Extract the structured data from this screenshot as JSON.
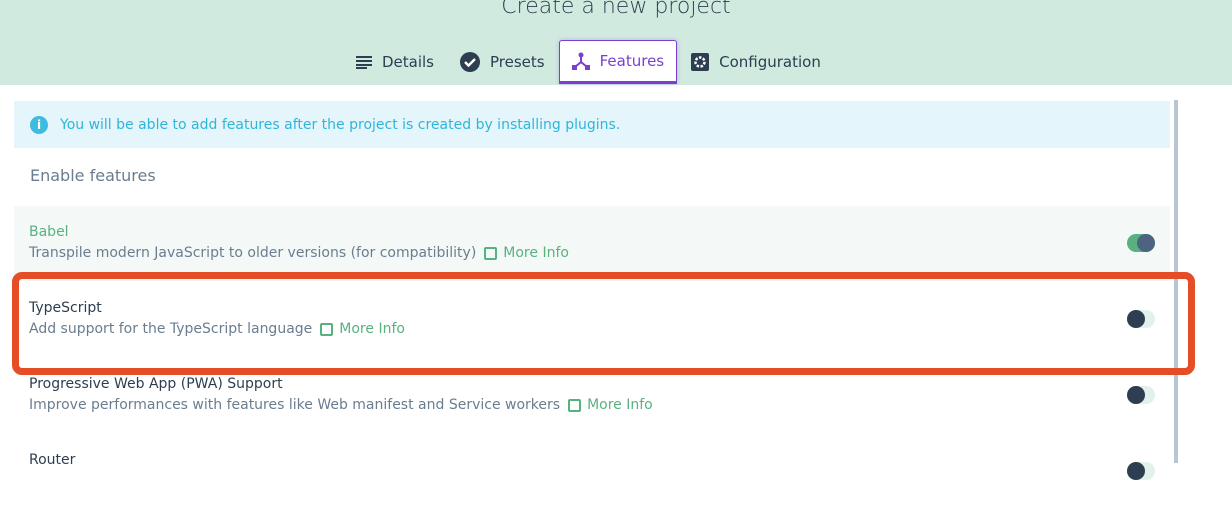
{
  "header": {
    "title": "Create a new project",
    "tabs": [
      {
        "label": "Details",
        "icon": "list-icon"
      },
      {
        "label": "Presets",
        "icon": "check-circle-icon"
      },
      {
        "label": "Features",
        "icon": "fork-icon",
        "active": true
      },
      {
        "label": "Configuration",
        "icon": "gear-icon"
      }
    ]
  },
  "info": {
    "text": "You will be able to add features after the project is created by installing plugins."
  },
  "section_title": "Enable features",
  "features": [
    {
      "name": "Babel",
      "description": "Transpile modern JavaScript to older versions (for compatibility)",
      "link": "More Info",
      "enabled": true
    },
    {
      "name": "TypeScript",
      "description": "Add support for the TypeScript language",
      "link": "More Info",
      "enabled": false
    },
    {
      "name": "Progressive Web App (PWA) Support",
      "description": "Improve performances with features like Web manifest and Service workers",
      "link": "More Info",
      "enabled": false
    },
    {
      "name": "Router",
      "enabled": false
    }
  ],
  "colors": {
    "accent": "#7a3fd0",
    "green": "#58b27f",
    "highlight": "#e44d26"
  }
}
